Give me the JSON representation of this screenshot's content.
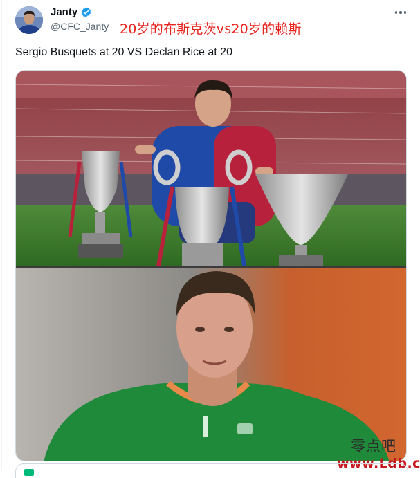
{
  "tweet": {
    "author": {
      "display_name": "Janty",
      "handle": "@CFC_Janty",
      "verified": true,
      "verified_color": "#1d9bf0"
    },
    "overlay_caption": "20岁的布斯克茨vs20岁的赖斯",
    "text": "Sergio Busquets at 20 VS Declan Rice at 20",
    "more_icon": "more-horizontal-icon"
  },
  "watermark": {
    "chinese": "零点吧",
    "url": "www.Ldb.cc",
    "url_color": "#c8161d"
  },
  "colors": {
    "caption_red": "#e8231c",
    "handle_grey": "#536471",
    "text": "#0f1419"
  }
}
